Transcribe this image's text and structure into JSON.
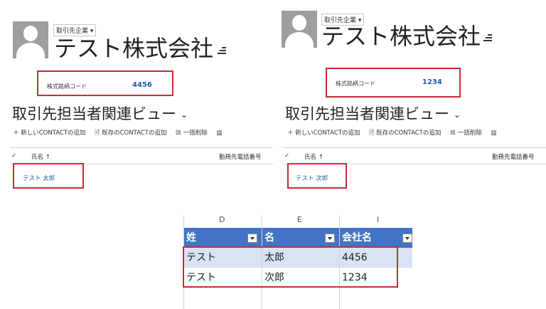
{
  "left": {
    "entity_type": "取引先企業 ▾",
    "company_name": "テスト株式会社",
    "field_label": "株式銘柄コード",
    "field_value": "4456",
    "view_title": "取引先担当者関連ビュー",
    "view_chevron": "⌄",
    "commands": [
      "＋ 新しいCONTACTの追加",
      "既存のCONTACTの追加",
      "一括削除"
    ],
    "col_name": "氏名 ↑",
    "col_phone": "勤務先電話番号",
    "record": "テスト 太郎"
  },
  "right": {
    "entity_type": "取引先企業 ▾",
    "company_name": "テスト株式会社",
    "field_label": "株式銘柄コード",
    "field_value": "1234",
    "view_title": "取引先担当者関連ビュー",
    "view_chevron": "⌄",
    "commands": [
      "＋ 新しいCONTACTの追加",
      "既存のCONTACTの追加",
      "一括削除"
    ],
    "col_name": "氏名 ↑",
    "col_phone": "勤務先電話番号",
    "record": "テスト 次郎"
  },
  "excel": {
    "columns": [
      "D",
      "E",
      "I"
    ],
    "headers": [
      "姓",
      "名",
      "会社名"
    ],
    "rows": [
      [
        "テスト",
        "太郎",
        "4456"
      ],
      [
        "テスト",
        "次郎",
        "1234"
      ]
    ],
    "header_color": "#4472c4",
    "band_color": "#dae3f3"
  },
  "colors": {
    "highlight": "#cc2b3a",
    "link": "#1a5fa8"
  }
}
